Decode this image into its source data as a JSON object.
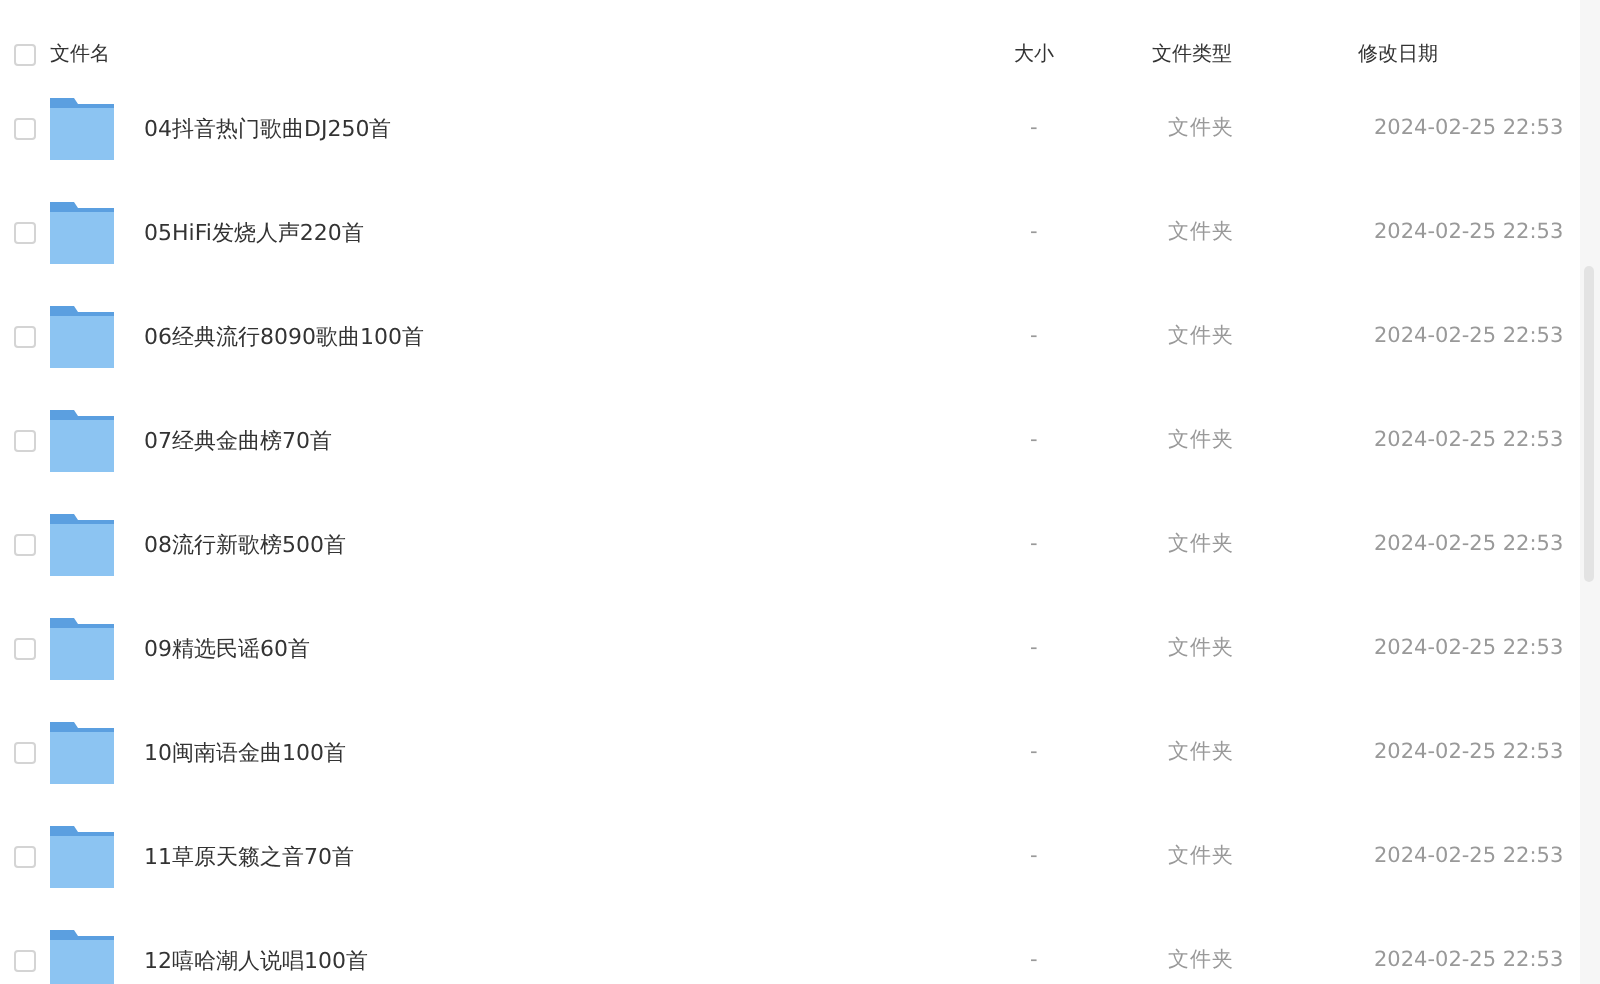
{
  "table": {
    "columns": [
      "文件名",
      "大小",
      "文件类型",
      "修改日期"
    ],
    "header_checked": false,
    "rows": [
      {
        "name": "04抖音热门歌曲DJ250首",
        "size": "-",
        "type": "文件夹",
        "modified": "2024-02-25 22:53",
        "checked": false
      },
      {
        "name": "05HiFi发烧人声220首",
        "size": "-",
        "type": "文件夹",
        "modified": "2024-02-25 22:53",
        "checked": false
      },
      {
        "name": "06经典流行8090歌曲100首",
        "size": "-",
        "type": "文件夹",
        "modified": "2024-02-25 22:53",
        "checked": false
      },
      {
        "name": "07经典金曲榜70首",
        "size": "-",
        "type": "文件夹",
        "modified": "2024-02-25 22:53",
        "checked": false
      },
      {
        "name": "08流行新歌榜500首",
        "size": "-",
        "type": "文件夹",
        "modified": "2024-02-25 22:53",
        "checked": false
      },
      {
        "name": "09精选民谣60首",
        "size": "-",
        "type": "文件夹",
        "modified": "2024-02-25 22:53",
        "checked": false
      },
      {
        "name": "10闽南语金曲100首",
        "size": "-",
        "type": "文件夹",
        "modified": "2024-02-25 22:53",
        "checked": false
      },
      {
        "name": "11草原天籁之音70首",
        "size": "-",
        "type": "文件夹",
        "modified": "2024-02-25 22:53",
        "checked": false
      },
      {
        "name": "12嘻哈潮人说唱100首",
        "size": "-",
        "type": "文件夹",
        "modified": "2024-02-25 22:53",
        "checked": false
      }
    ]
  }
}
